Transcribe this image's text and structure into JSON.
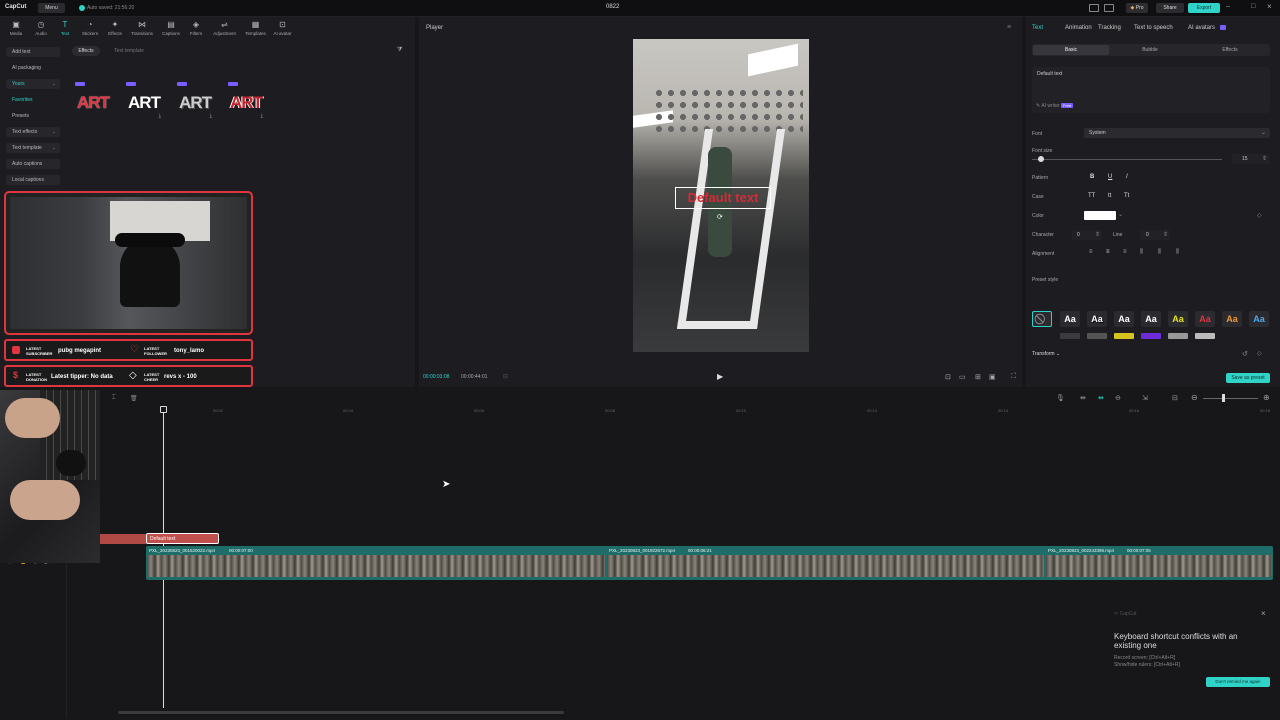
{
  "titlebar": {
    "logo": "CapCut",
    "menu": "Menu",
    "autosave": "Auto saved: 21:56:20",
    "project": "0822",
    "pro": "Pro",
    "share": "Share",
    "export": "Export"
  },
  "toolbar": [
    "Media",
    "Audio",
    "Text",
    "Stickers",
    "Effects",
    "Transitions",
    "Captions",
    "Filters",
    "Adjustment",
    "Templates",
    "AI avatar"
  ],
  "sidebar": {
    "items": [
      "Add text",
      "AI packaging",
      "Yours",
      "Favorites",
      "Presets",
      "Text effects",
      "Text template",
      "Auto captions",
      "Local captions"
    ]
  },
  "filter_tabs": {
    "effects": "Effects",
    "text_template": "Text template"
  },
  "templates": {
    "label": "ART",
    "free_badge": "Free"
  },
  "overlay": {
    "sub_label": "LATEST SUBSCRIBER",
    "sub_value": "pubg megapint",
    "follow_label": "LATEST FOLLOWER",
    "follow_value": "tony_lamo",
    "donation_label": "LATEST DONATION",
    "donation_value": "Latest tipper: No data",
    "cheer_label": "LATEST CHEER",
    "cheer_value": "revs x - 100"
  },
  "player": {
    "title": "Player",
    "overlay_text": "Default text",
    "current_time": "00:00:03:08",
    "total_time": "00:00:44:01"
  },
  "right": {
    "tabs": [
      "Text",
      "Animation",
      "Tracking",
      "Text to speech",
      "AI avatars"
    ],
    "subtabs": [
      "Basic",
      "Bubble",
      "Effects"
    ],
    "text_value": "Default text",
    "ai_writer": "AI writer",
    "ai_writer_badge": "Free",
    "font_label": "Font",
    "font_value": "System",
    "font_size_label": "Font size",
    "font_size_value": "15",
    "pattern_label": "Pattern",
    "case_label": "Case",
    "color_label": "Color",
    "character_label": "Character",
    "character_value": "0",
    "line_label": "Line",
    "line_value": "0",
    "alignment_label": "Alignment",
    "preset_label": "Preset style",
    "transform_label": "Transform",
    "save_preset": "Save as preset",
    "pattern_opts": [
      "B",
      "U",
      "I"
    ],
    "case_opts": [
      "TT",
      "tt",
      "Tt"
    ],
    "preset_text": "Aa"
  },
  "timeline": {
    "ruler": [
      "00:02",
      "00:04",
      "00:06",
      "00:08",
      "00:10",
      "00:12",
      "00:14",
      "00:16",
      "00:18"
    ],
    "text_clip": "Default text",
    "clips": [
      {
        "name": "PXL_20230823_001520022.mp4",
        "dur": "00:00:07:00"
      },
      {
        "name": "PXL_20230823_001922672.mp4",
        "dur": "00:00:06:21"
      },
      {
        "name": "PXL_20230823_002243396.mp4",
        "dur": "00:00:07:05"
      }
    ]
  },
  "toast": {
    "app": "CapCut",
    "title": "Keyboard shortcut conflicts with an existing one",
    "line1": "Record screen: [Ctrl+Alt+R]",
    "line2": "Show/hide rulers: [Ctrl+Alt+R]",
    "button": "Don't remind me again"
  },
  "colors": {
    "accent": "#2fd3c8",
    "overlay_red": "#e0353f",
    "free_badge": "#7b5cff"
  }
}
